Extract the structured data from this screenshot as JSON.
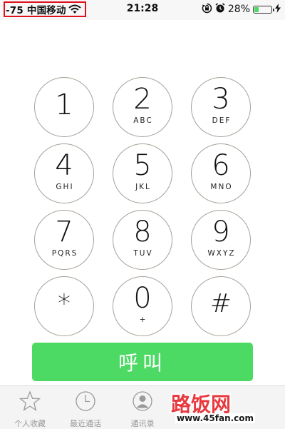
{
  "status_bar": {
    "signal_carrier": "-75 中国移动",
    "time": "21:28",
    "battery_percent": "28%",
    "battery_level": 0.28,
    "icons": [
      "wifi-icon",
      "rotation-lock-icon",
      "alarm-icon",
      "battery-icon",
      "charging-icon"
    ]
  },
  "keypad": [
    {
      "digit": "1",
      "letters": ""
    },
    {
      "digit": "2",
      "letters": "ABC"
    },
    {
      "digit": "3",
      "letters": "DEF"
    },
    {
      "digit": "4",
      "letters": "GHI"
    },
    {
      "digit": "5",
      "letters": "JKL"
    },
    {
      "digit": "6",
      "letters": "MNO"
    },
    {
      "digit": "7",
      "letters": "PQRS"
    },
    {
      "digit": "8",
      "letters": "TUV"
    },
    {
      "digit": "9",
      "letters": "WXYZ"
    },
    {
      "digit": "*",
      "letters": ""
    },
    {
      "digit": "0",
      "letters": "+"
    },
    {
      "digit": "#",
      "letters": ""
    }
  ],
  "call_button": {
    "label": "呼叫",
    "color": "#4cd964"
  },
  "tabs": [
    {
      "label": "个人收藏",
      "icon": "star-icon"
    },
    {
      "label": "最近通话",
      "icon": "clock-icon"
    },
    {
      "label": "通讯录",
      "icon": "contacts-icon"
    }
  ],
  "watermark": {
    "logo": "路饭网",
    "url": "www.45fan.com"
  }
}
